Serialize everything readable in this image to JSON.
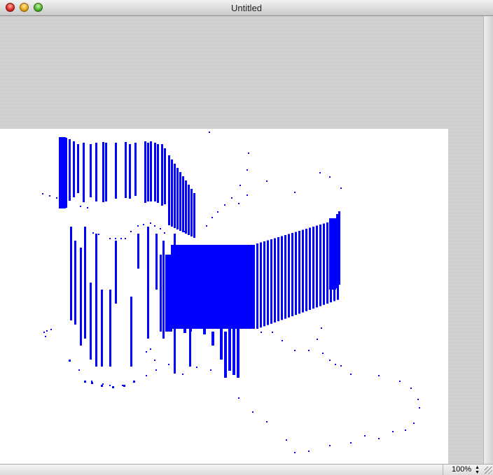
{
  "window": {
    "title": "Untitled"
  },
  "status": {
    "zoom": "100%"
  },
  "icons": {
    "close": "close-button-icon",
    "minimize": "minimize-button-icon",
    "zoom": "zoom-button-icon",
    "stepper": "up-down-arrows-icon",
    "resize": "resize-grip-icon"
  },
  "colors": {
    "drawing": "#0000ff",
    "canvas": "#ffffff",
    "window_background": "#d0d0d0"
  }
}
